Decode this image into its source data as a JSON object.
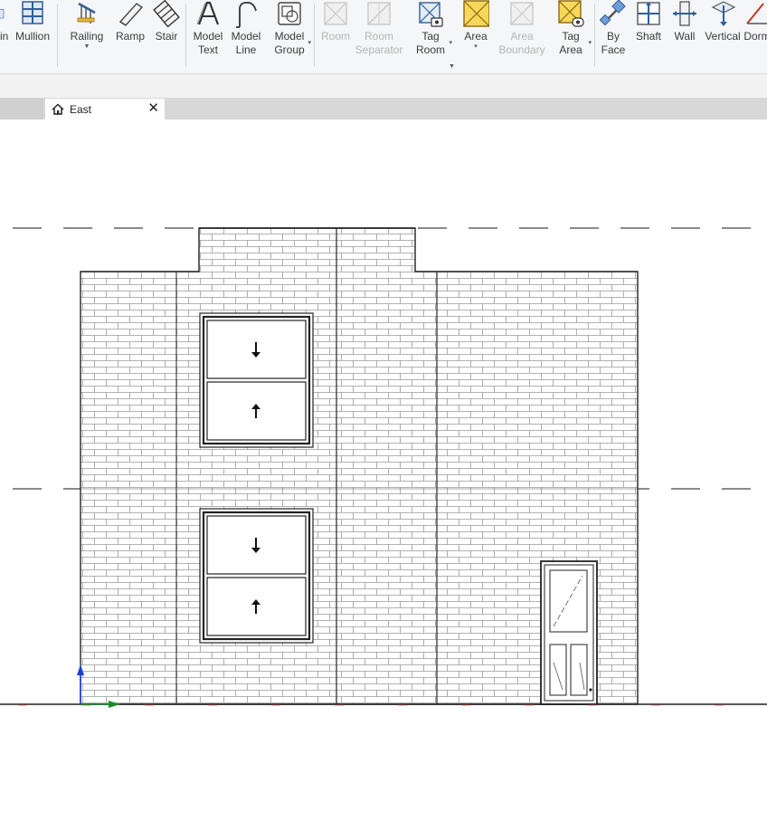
{
  "ribbon": {
    "tools": [
      {
        "name": "curtain-mullion-partial",
        "label": "in",
        "icon": "curtain-system-icon",
        "disabled": false
      },
      {
        "name": "mullion",
        "label": "Mullion",
        "icon": "mullion-icon",
        "disabled": false
      },
      {
        "name": "railing",
        "label": "Railing",
        "icon": "railing-icon",
        "disabled": false
      },
      {
        "name": "ramp",
        "label": "Ramp",
        "icon": "ramp-icon",
        "disabled": false
      },
      {
        "name": "stair",
        "label": "Stair",
        "icon": "stair-icon",
        "disabled": false
      },
      {
        "name": "model-text",
        "label": "Model\nText",
        "icon": "model-text-icon",
        "disabled": false
      },
      {
        "name": "model-line",
        "label": "Model\nLine",
        "icon": "model-line-icon",
        "disabled": false
      },
      {
        "name": "model-group",
        "label": "Model\nGroup",
        "icon": "model-group-icon",
        "disabled": false
      },
      {
        "name": "room",
        "label": "Room",
        "icon": "room-icon",
        "disabled": true
      },
      {
        "name": "room-separator",
        "label": "Room\nSeparator",
        "icon": "room-separator-icon",
        "disabled": true
      },
      {
        "name": "tag-room",
        "label": "Tag\nRoom",
        "icon": "tag-room-icon",
        "disabled": false
      },
      {
        "name": "area",
        "label": "Area",
        "icon": "area-icon",
        "disabled": false
      },
      {
        "name": "area-boundary",
        "label": "Area\nBoundary",
        "icon": "area-boundary-icon",
        "disabled": true
      },
      {
        "name": "tag-area",
        "label": "Tag\nArea",
        "icon": "tag-area-icon",
        "disabled": false
      },
      {
        "name": "by-face",
        "label": "By\nFace",
        "icon": "by-face-icon",
        "disabled": false
      },
      {
        "name": "shaft",
        "label": "Shaft",
        "icon": "shaft-icon",
        "disabled": false
      },
      {
        "name": "wall-opening",
        "label": "Wall",
        "icon": "wall-opening-icon",
        "disabled": false
      },
      {
        "name": "vertical-opening",
        "label": "Vertical",
        "icon": "vertical-opening-icon",
        "disabled": false
      },
      {
        "name": "dormer-opening",
        "label": "Dorm",
        "icon": "dormer-icon",
        "disabled": false
      }
    ]
  },
  "view_tab": {
    "label": "East",
    "icon": "house-icon",
    "close_icon": "close-icon"
  },
  "drawing": {
    "view": "East elevation",
    "window_arrows": [
      "down-arrow-icon",
      "up-arrow-icon"
    ],
    "colors": {
      "line": "#222222",
      "brick": "#9a9a9a",
      "origin_y": "#1b3fd6",
      "origin_x": "#1f8a2a",
      "ground_marks": "#d9534f"
    }
  }
}
